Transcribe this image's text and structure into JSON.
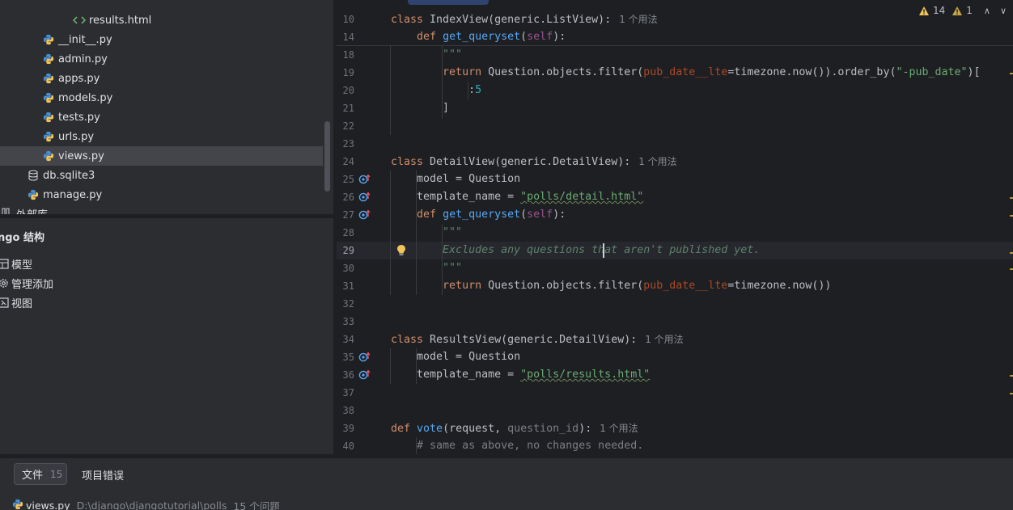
{
  "project_tree": {
    "items": [
      {
        "label": "results.html",
        "icon": "html-file-icon"
      },
      {
        "label": "__init__.py",
        "icon": "python-file-icon"
      },
      {
        "label": "admin.py",
        "icon": "python-file-icon"
      },
      {
        "label": "apps.py",
        "icon": "python-file-icon"
      },
      {
        "label": "models.py",
        "icon": "python-file-icon"
      },
      {
        "label": "tests.py",
        "icon": "python-file-icon"
      },
      {
        "label": "urls.py",
        "icon": "python-file-icon"
      },
      {
        "label": "views.py",
        "icon": "python-file-icon",
        "selected": true
      },
      {
        "label": "db.sqlite3",
        "icon": "database-icon"
      },
      {
        "label": "manage.py",
        "icon": "python-file-icon"
      },
      {
        "label": "外部库",
        "icon": "library-icon"
      }
    ]
  },
  "structure_panel": {
    "title": "ngo 结构",
    "items": [
      {
        "label": "模型",
        "icon": "table-icon"
      },
      {
        "label": "管理添加",
        "icon": "gear-icon"
      },
      {
        "label": "视图",
        "icon": "view-icon"
      }
    ]
  },
  "editor": {
    "problems": {
      "warnings": "14",
      "weak_warnings": "1"
    },
    "sticky_lines": [
      {
        "num": "10",
        "tokens": [
          [
            "kw",
            "class "
          ],
          [
            "",
            "IndexView(generic.ListView):"
          ]
        ],
        "hint": "1 个用法"
      },
      {
        "num": "14",
        "tokens": [
          [
            "",
            "    "
          ],
          [
            "kw",
            "def "
          ],
          [
            "fn",
            "get_queryset"
          ],
          [
            "",
            "("
          ],
          [
            "self",
            "self"
          ],
          [
            "",
            "):"
          ]
        ]
      }
    ],
    "lines": [
      {
        "num": "18",
        "tokens": [
          [
            "",
            "        "
          ],
          [
            "doc",
            "\"\"\""
          ]
        ]
      },
      {
        "num": "19",
        "tokens": [
          [
            "",
            "        "
          ],
          [
            "kw",
            "return "
          ],
          [
            "",
            "Question.objects.filter("
          ],
          [
            "param",
            "pub_date__lte"
          ],
          [
            "",
            "=timezone.now()).order_by("
          ],
          [
            "str",
            "\"-pub_date\""
          ],
          [
            "",
            ")["
          ]
        ]
      },
      {
        "num": "20",
        "tokens": [
          [
            "",
            "            :"
          ],
          [
            "num",
            "5"
          ]
        ]
      },
      {
        "num": "21",
        "tokens": [
          [
            "",
            "        ]"
          ]
        ]
      },
      {
        "num": "22",
        "tokens": []
      },
      {
        "num": "23",
        "tokens": []
      },
      {
        "num": "24",
        "tokens": [
          [
            "kw",
            "class "
          ],
          [
            "",
            "DetailView(generic.DetailView):"
          ]
        ],
        "hint": "1 个用法"
      },
      {
        "num": "25",
        "tokens": [
          [
            "",
            "    model = Question"
          ]
        ],
        "override": true
      },
      {
        "num": "26",
        "tokens": [
          [
            "",
            "    template_name = "
          ],
          [
            "str typo",
            "\"polls/detail.html\""
          ]
        ],
        "override": true
      },
      {
        "num": "27",
        "tokens": [
          [
            "",
            "    "
          ],
          [
            "kw",
            "def "
          ],
          [
            "fn",
            "get_queryset"
          ],
          [
            "",
            "("
          ],
          [
            "self",
            "self"
          ],
          [
            "",
            "):"
          ]
        ],
        "override": true
      },
      {
        "num": "28",
        "tokens": [
          [
            "",
            "        "
          ],
          [
            "doc",
            "\"\"\""
          ]
        ]
      },
      {
        "num": "29",
        "tokens": [
          [
            "",
            "        "
          ],
          [
            "doc",
            "Excludes any questions that aren't published yet."
          ]
        ],
        "current": true,
        "bulb": true
      },
      {
        "num": "30",
        "tokens": [
          [
            "",
            "        "
          ],
          [
            "doc",
            "\"\"\""
          ]
        ]
      },
      {
        "num": "31",
        "tokens": [
          [
            "",
            "        "
          ],
          [
            "kw",
            "return "
          ],
          [
            "",
            "Question.objects.filter("
          ],
          [
            "param",
            "pub_date__lte"
          ],
          [
            "",
            "=timezone.now())"
          ]
        ]
      },
      {
        "num": "32",
        "tokens": []
      },
      {
        "num": "33",
        "tokens": []
      },
      {
        "num": "34",
        "tokens": [
          [
            "kw",
            "class "
          ],
          [
            "",
            "ResultsView(generic.DetailView):"
          ]
        ],
        "hint": "1 个用法"
      },
      {
        "num": "35",
        "tokens": [
          [
            "",
            "    model = Question"
          ]
        ],
        "override": true
      },
      {
        "num": "36",
        "tokens": [
          [
            "",
            "    template_name = "
          ],
          [
            "str typo",
            "\"polls/results.html\""
          ]
        ],
        "override": true
      },
      {
        "num": "37",
        "tokens": []
      },
      {
        "num": "38",
        "tokens": []
      },
      {
        "num": "39",
        "tokens": [
          [
            "kw",
            "def "
          ],
          [
            "fn",
            "vote"
          ],
          [
            "",
            "(request, "
          ],
          [
            "cmt",
            "question_id"
          ],
          [
            "",
            "):"
          ]
        ],
        "hint": "1 个用法"
      },
      {
        "num": "40",
        "tokens": [
          [
            "",
            "    "
          ],
          [
            "cmt",
            "# same as above, no changes needed."
          ]
        ]
      }
    ]
  },
  "bottom_panel": {
    "tab_files": "文件",
    "tab_files_count": "15",
    "tab_errors": "项目错误",
    "file_name": "views.py",
    "file_dir": "D:\\django\\djangotutorial\\polls",
    "problem_count": "15 个问题"
  },
  "colors": {
    "background": "#1e1f22",
    "panel": "#2b2d30",
    "selection": "#43454a",
    "keyword": "#cf8e6d",
    "function": "#56a8f5",
    "string": "#6aab73",
    "warning": "#f2c55c"
  }
}
